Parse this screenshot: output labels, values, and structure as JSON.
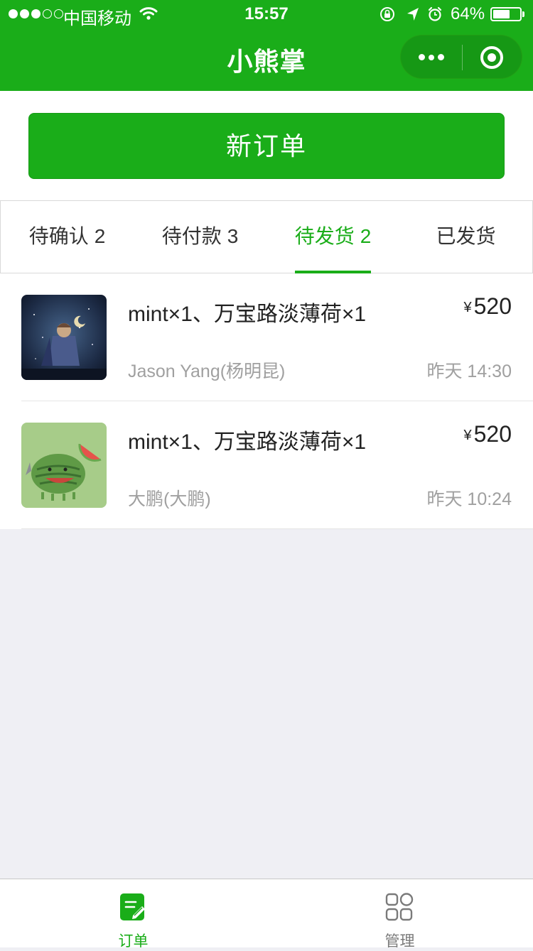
{
  "colors": {
    "brand": "#1aad19",
    "background": "#efeff4",
    "muted": "#a0a0a0"
  },
  "status_bar": {
    "signal_bars_filled": 3,
    "signal_bars_total": 5,
    "carrier": "中国移动",
    "time": "15:57",
    "battery_percent": "64%",
    "battery_level": 0.64,
    "icons": [
      "wifi-icon",
      "rotation-lock-icon",
      "location-icon",
      "alarm-icon",
      "battery-icon"
    ]
  },
  "nav": {
    "title": "小熊掌",
    "more_icon": "more-icon",
    "close_icon": "target-icon"
  },
  "new_order_button": {
    "label": "新订单"
  },
  "tabs": [
    {
      "label": "待确认",
      "count": "2",
      "active": false
    },
    {
      "label": "待付款",
      "count": "3",
      "active": false
    },
    {
      "label": "待发货",
      "count": "2",
      "active": true
    },
    {
      "label": "已发货",
      "count": "",
      "active": false
    }
  ],
  "orders": [
    {
      "items": "mint×1、万宝路淡薄荷×1",
      "currency": "¥",
      "price": "520",
      "customer": "Jason Yang(杨明昆)",
      "time": "昨天 14:30"
    },
    {
      "items": "mint×1、万宝路淡薄荷×1",
      "currency": "¥",
      "price": "520",
      "customer": "大鹏(大鹏)",
      "time": "昨天 10:24"
    }
  ],
  "tabbar": [
    {
      "label": "订单",
      "icon": "order-icon",
      "active": true
    },
    {
      "label": "管理",
      "icon": "grid-icon",
      "active": false
    }
  ]
}
